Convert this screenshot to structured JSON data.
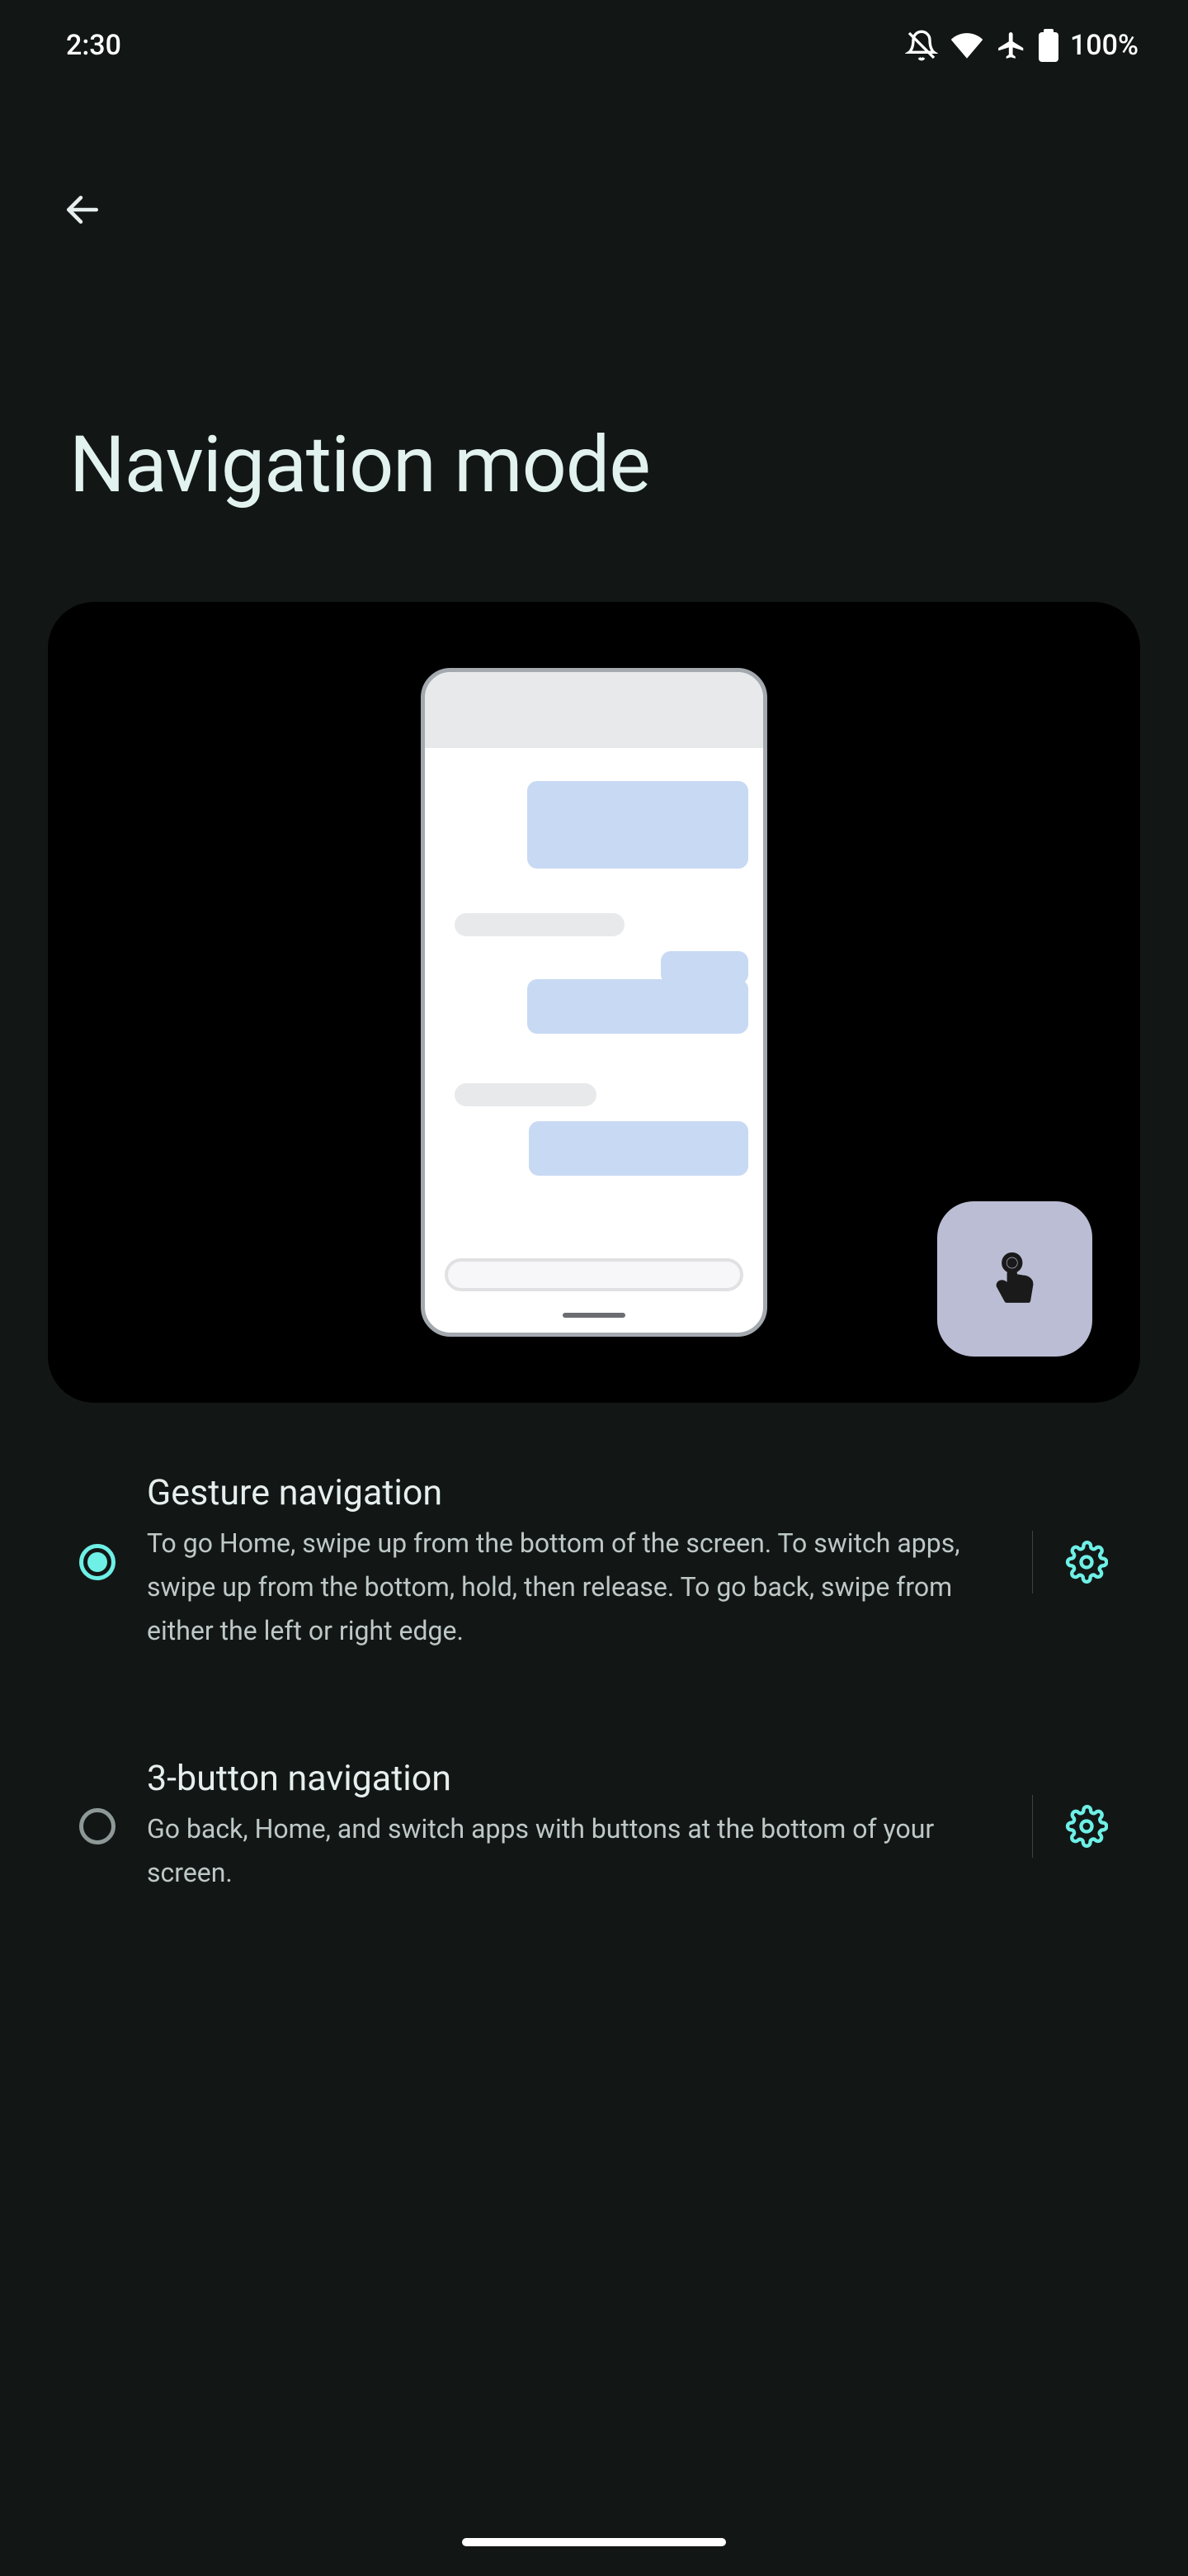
{
  "status": {
    "time": "2:30",
    "battery": "100%"
  },
  "header": {
    "title": "Navigation mode"
  },
  "options": [
    {
      "title": "Gesture navigation",
      "description": "To go Home, swipe up from the bottom of the screen. To switch apps, swipe up from the bottom, hold, then release. To go back, swipe from either the left or right edge.",
      "selected": true
    },
    {
      "title": "3-button navigation",
      "description": "Go back, Home, and switch apps with buttons at the bottom of your screen.",
      "selected": false
    }
  ],
  "accent": "#6EF0E6"
}
